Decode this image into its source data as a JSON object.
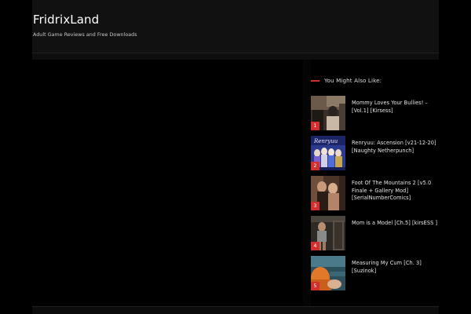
{
  "header": {
    "site_title": "FridrixLand",
    "tagline": "Adult Game Reviews and Free Downloads"
  },
  "sidebar": {
    "widget_title": "You Might Also Like:",
    "accent_color": "#d32f2f",
    "posts": [
      {
        "rank": "1",
        "title": "Mommy Loves Your Bullies! – [Vol.1] [Kirsess]",
        "thumb_icon": "dark-room-scene-thumbnail"
      },
      {
        "rank": "2",
        "title": "Renryuu: Ascension [v21-12-20] [Naughty Netherpunch]",
        "thumb_icon": "anime-group-cover-thumbnail"
      },
      {
        "rank": "3",
        "title": "Foot Of The Mountains 2 [v5.0 Finale + Gallery Mod] [SerialNumberComics]",
        "thumb_icon": "couple-scene-thumbnail"
      },
      {
        "rank": "4",
        "title": "Mom is a Model [Ch.5] [kirsESS ]",
        "thumb_icon": "hallway-scene-thumbnail"
      },
      {
        "rank": "5",
        "title": "Measuring My Cum [Ch. 3] [Suzinok]",
        "thumb_icon": "orange-outfit-scene-thumbnail"
      }
    ]
  }
}
